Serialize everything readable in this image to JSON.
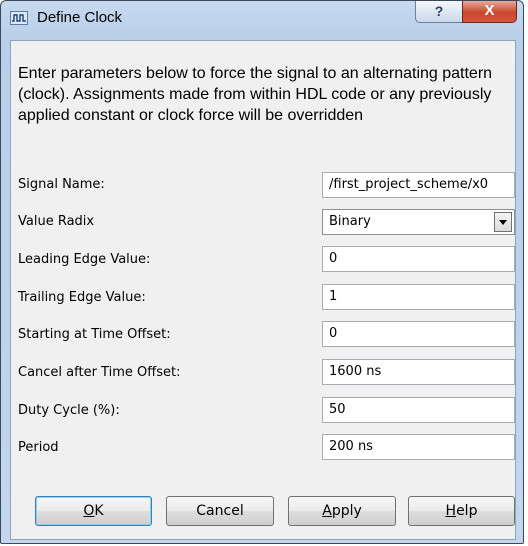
{
  "window": {
    "title": "Define Clock",
    "help_glyph": "?",
    "close_glyph": "X"
  },
  "description": "Enter parameters below to force the signal to an alternating pattern (clock). Assignments made from within HDL code or any previously applied constant or clock force will be overridden",
  "fields": [
    {
      "label": "Signal Name:",
      "value": "/first_project_scheme/x0",
      "kind": "text"
    },
    {
      "label": "Value Radix",
      "value": "Binary",
      "kind": "select"
    },
    {
      "label": "Leading Edge Value:",
      "value": "0",
      "kind": "text"
    },
    {
      "label": "Trailing Edge Value:",
      "value": "1",
      "kind": "text"
    },
    {
      "label": "Starting at Time Offset:",
      "value": "0",
      "kind": "text"
    },
    {
      "label": "Cancel after Time Offset:",
      "value": "1600 ns",
      "kind": "text"
    },
    {
      "label": "Duty Cycle (%):",
      "value": "50",
      "kind": "text"
    },
    {
      "label": "Period",
      "value": "200 ns",
      "kind": "text"
    }
  ],
  "buttons": {
    "ok": {
      "mnemonic": "O",
      "rest": "K"
    },
    "cancel": "Cancel",
    "apply": {
      "mnemonic": "A",
      "rest": "pply"
    },
    "help": {
      "mnemonic": "H",
      "rest": "elp"
    }
  },
  "icons": {
    "title": "clock-wave-icon",
    "dropdown": "chevron-down-icon"
  }
}
